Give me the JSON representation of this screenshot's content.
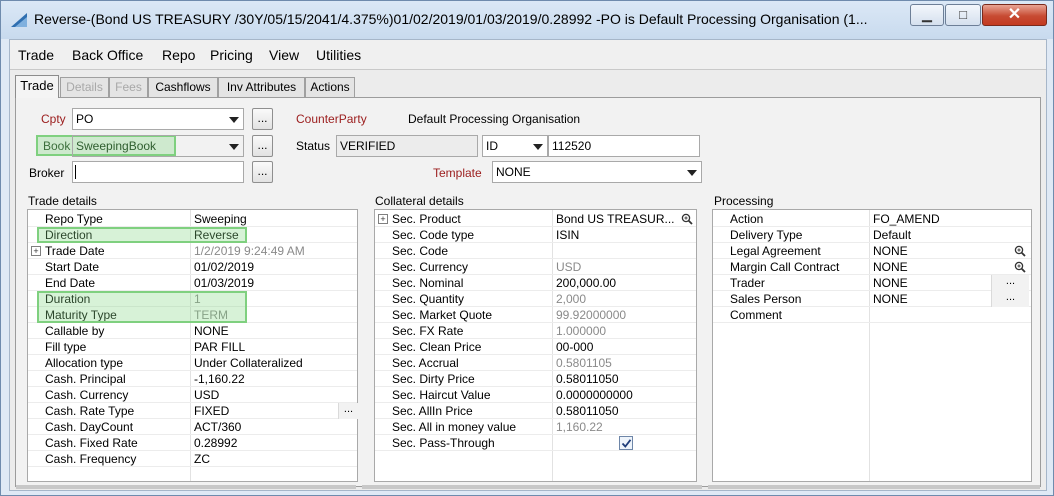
{
  "window": {
    "title": "Reverse-(Bond US TREASURY /30Y/05/15/2041/4.375%)01/02/2019/01/03/2019/0.28992  -PO is Default Processing Organisation  (1...",
    "minimize_glyph": "▁",
    "maximize_glyph": "□",
    "close_glyph": "✕"
  },
  "menu": [
    "Trade",
    "Back Office",
    "Repo",
    "Pricing",
    "View",
    "Utilities"
  ],
  "tabs": [
    {
      "label": "Trade",
      "state": "active"
    },
    {
      "label": "Details",
      "state": "disabled"
    },
    {
      "label": "Fees",
      "state": "disabled"
    },
    {
      "label": "Cashflows",
      "state": "normal"
    },
    {
      "label": "Inv Attributes",
      "state": "normal"
    },
    {
      "label": "Actions",
      "state": "normal"
    }
  ],
  "form": {
    "cpty_label": "Cpty",
    "cpty_value": "PO",
    "counterparty_label": "CounterParty",
    "counterparty_value": "Default Processing Organisation",
    "book_label": "Book",
    "book_value": "SweepingBook",
    "status_label": "Status",
    "status_value": "VERIFIED",
    "id_type": "ID",
    "id_value": "112520",
    "broker_label": "Broker",
    "broker_value": "",
    "template_label": "Template",
    "template_value": "NONE",
    "ellipsis": "..."
  },
  "trade_details": {
    "title": "Trade details",
    "rows": [
      {
        "k": "Repo Type",
        "v": "Sweeping"
      },
      {
        "k": "Direction",
        "v": "Reverse"
      },
      {
        "k": "Trade Date",
        "v": "1/2/2019 9:24:49 AM"
      },
      {
        "k": "Start Date",
        "v": "01/02/2019"
      },
      {
        "k": "End Date",
        "v": "01/03/2019"
      },
      {
        "k": "Duration",
        "v": "1"
      },
      {
        "k": "Maturity Type",
        "v": "TERM"
      },
      {
        "k": "Callable by",
        "v": "NONE"
      },
      {
        "k": "Fill type",
        "v": "PAR FILL"
      },
      {
        "k": "Allocation type",
        "v": "Under Collateralized"
      },
      {
        "k": "Cash. Principal",
        "v": "-1,160.22"
      },
      {
        "k": "Cash. Currency",
        "v": "USD"
      },
      {
        "k": "Cash. Rate Type",
        "v": "FIXED"
      },
      {
        "k": "Cash. DayCount",
        "v": "ACT/360"
      },
      {
        "k": "Cash. Fixed Rate",
        "v": "0.28992"
      },
      {
        "k": "Cash. Frequency",
        "v": "ZC"
      }
    ]
  },
  "collateral_details": {
    "title": "Collateral details",
    "rows": [
      {
        "k": "Sec. Product",
        "v": "Bond US TREASUR..."
      },
      {
        "k": "Sec. Code type",
        "v": "ISIN"
      },
      {
        "k": "Sec. Code",
        "v": ""
      },
      {
        "k": "Sec. Currency",
        "v": "USD"
      },
      {
        "k": "Sec. Nominal",
        "v": "200,000.00"
      },
      {
        "k": "Sec. Quantity",
        "v": "2,000"
      },
      {
        "k": "Sec. Market Quote",
        "v": "99.92000000"
      },
      {
        "k": "Sec. FX Rate",
        "v": "1.000000"
      },
      {
        "k": "Sec. Clean Price",
        "v": "00-000"
      },
      {
        "k": "Sec. Accrual",
        "v": "0.5801105"
      },
      {
        "k": "Sec. Dirty Price",
        "v": "0.58011050"
      },
      {
        "k": "Sec. Haircut Value",
        "v": "0.0000000000"
      },
      {
        "k": "Sec. AllIn Price",
        "v": "0.58011050"
      },
      {
        "k": "Sec. All in money value",
        "v": "1,160.22"
      },
      {
        "k": "Sec. Pass-Through",
        "v": ""
      }
    ],
    "pass_through_checked": true
  },
  "processing": {
    "title": "Processing",
    "rows": [
      {
        "k": "Action",
        "v": "FO_AMEND"
      },
      {
        "k": "Delivery Type",
        "v": "Default"
      },
      {
        "k": "Legal Agreement",
        "v": "NONE"
      },
      {
        "k": "Margin Call Contract",
        "v": "NONE"
      },
      {
        "k": "Trader",
        "v": "NONE"
      },
      {
        "k": "Sales Person",
        "v": "NONE"
      },
      {
        "k": "Comment",
        "v": ""
      }
    ]
  },
  "colors": {
    "highlight": "#7fd07f",
    "label_red": "#9b1c1c",
    "grey_value": "#8a8a8a"
  }
}
